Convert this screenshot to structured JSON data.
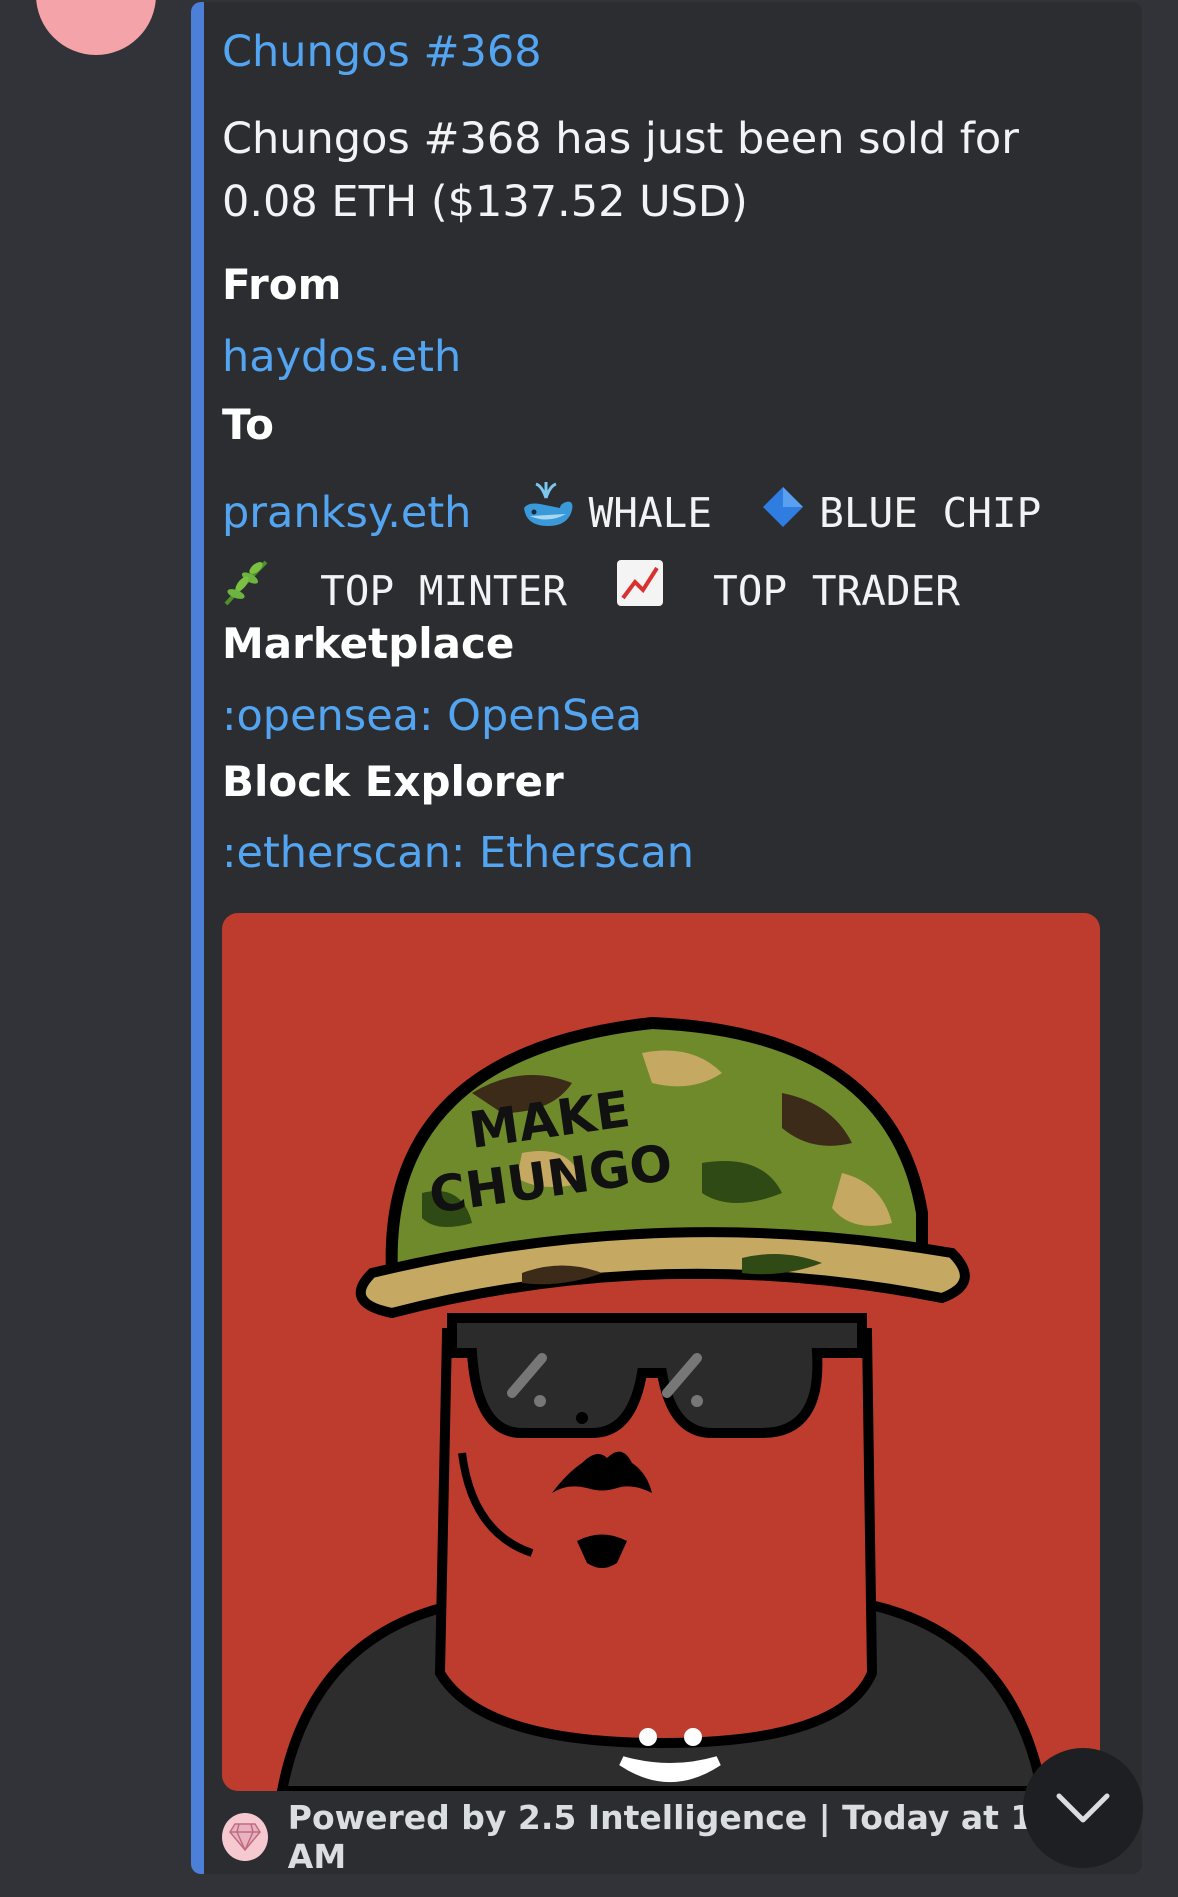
{
  "embed": {
    "title": "Chungos #368",
    "description": "Chungos #368 has just been sold for 0.08 ETH ($137.52 USD)",
    "accent_color": "#4c7fd8",
    "fields": {
      "from_label": "From",
      "from_value": "haydos.eth",
      "to_label": "To",
      "to_value": "pranksy.eth",
      "badges": [
        {
          "icon": "whale-emoji",
          "label": "WHALE"
        },
        {
          "icon": "blue-diamond-emoji",
          "label": "BLUE CHIP"
        },
        {
          "icon": "herb-emoji",
          "label": "TOP MINTER"
        },
        {
          "icon": "chart-increasing-emoji",
          "label": "TOP TRADER"
        }
      ],
      "marketplace_label": "Marketplace",
      "marketplace_value": ":opensea: OpenSea",
      "explorer_label": "Block Explorer",
      "explorer_value": ":etherscan: Etherscan"
    },
    "image": {
      "helmet_text_line1": "MAKE",
      "helmet_text_line2": "CHUNGO"
    },
    "footer": {
      "icon": "gem-icon",
      "text": "Powered by 2.5 Intelligence | Today at 1:33 AM"
    }
  },
  "scroll_button": {
    "icon": "chevron-down-icon"
  }
}
